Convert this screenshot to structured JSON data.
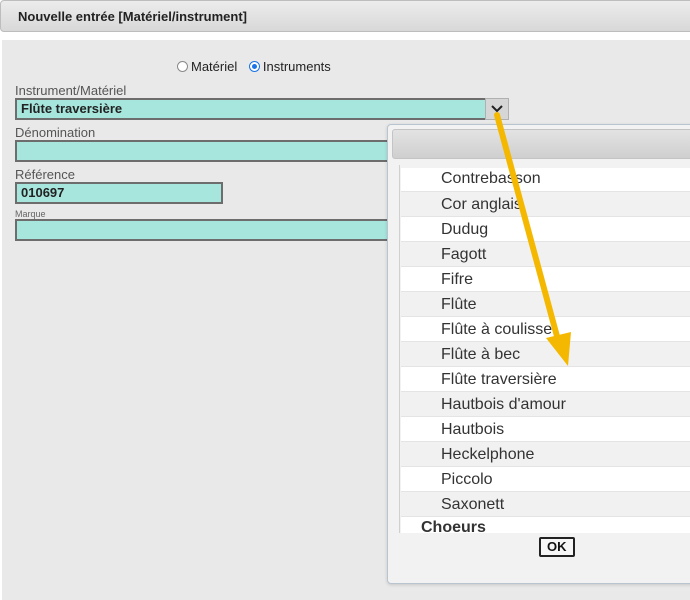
{
  "window": {
    "title": "Nouvelle entrée [Matériel/instrument]"
  },
  "type_selector": {
    "options": [
      {
        "label": "Matériel",
        "checked": false
      },
      {
        "label": "Instruments",
        "checked": true
      }
    ]
  },
  "form": {
    "instrument_label": "Instrument/Matériel",
    "instrument_value": "Flûte traversière",
    "denomination_label": "Dénomination",
    "denomination_value": "",
    "reference_label": "Référence",
    "reference_value": "010697",
    "marque_label": "Marque",
    "marque_value": ""
  },
  "picker": {
    "items": [
      "Contrebasson",
      "Cor anglais",
      "Dudug",
      "Fagott",
      "Fifre",
      "Flûte",
      "Flûte à coulisse",
      "Flûte à bec",
      "Flûte traversière",
      "Hautbois d'amour",
      "Hautbois",
      "Heckelphone",
      "Piccolo",
      "Saxonett"
    ],
    "next_group": "Choeurs",
    "ok_label": "OK"
  },
  "colors": {
    "field_bg": "#a7e6dd",
    "arrow": "#f5b800",
    "radio_checked": "#1a73e8"
  }
}
